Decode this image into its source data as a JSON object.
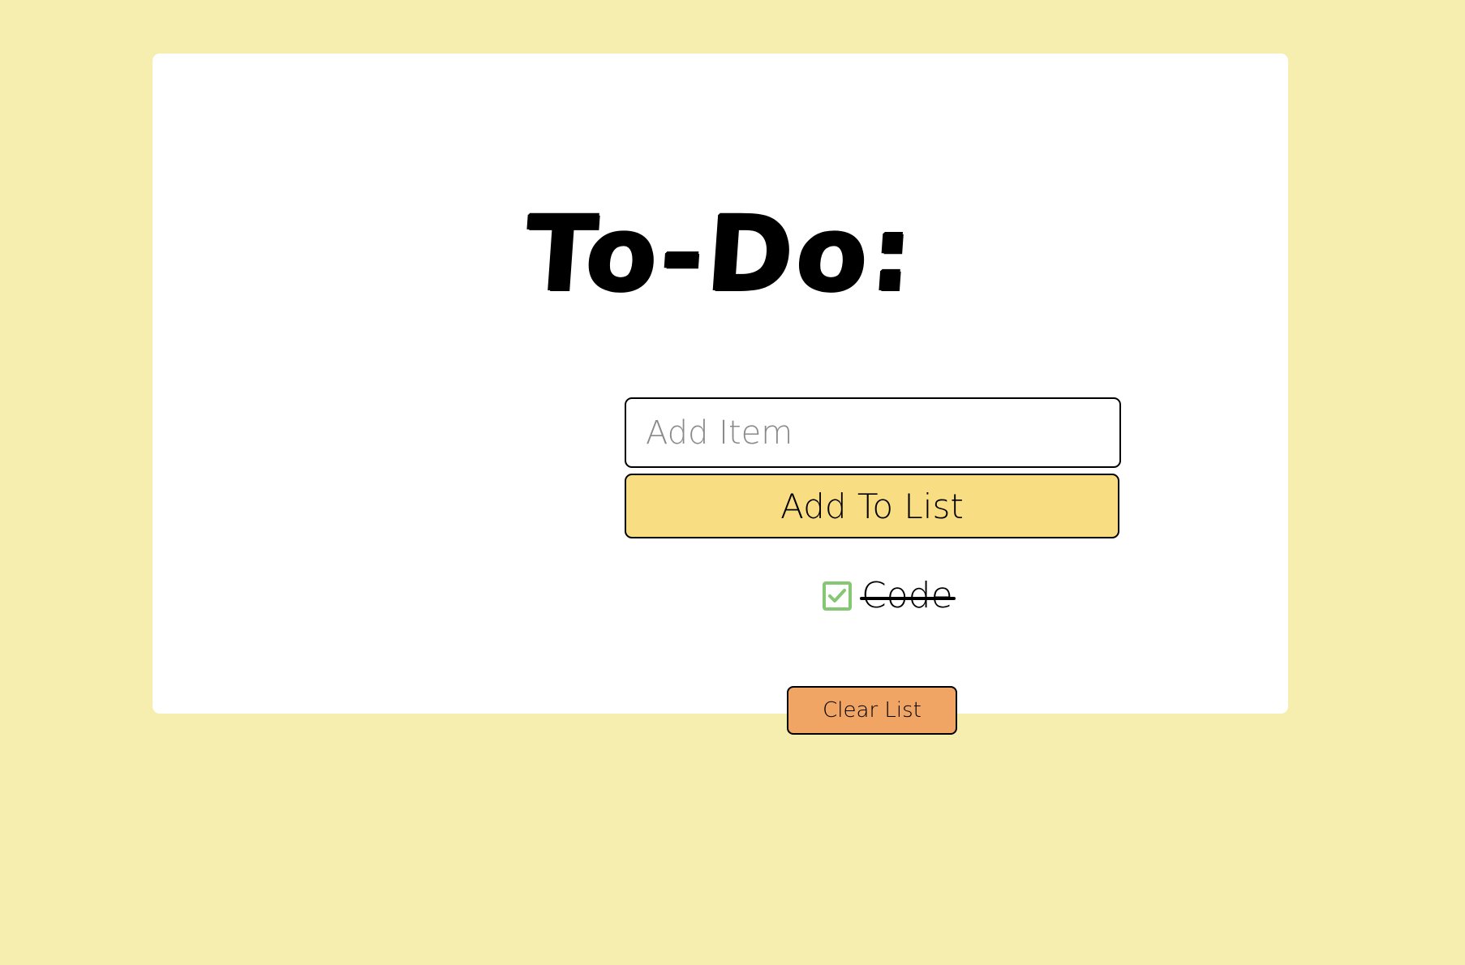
{
  "page": {
    "background_color": "#F5EEAF",
    "card_color": "#FFFFFF"
  },
  "header": {
    "title": "To-Do:"
  },
  "add_item": {
    "placeholder": "Add Item",
    "value": "",
    "button_label": "Add To List",
    "button_color": "#F9DD83"
  },
  "todo_list": {
    "items": [
      {
        "label": "Code",
        "checked": true,
        "checkbox_color": "#86C774",
        "check_icon": "check-icon"
      }
    ]
  },
  "actions": {
    "clear_label": "Clear List",
    "clear_color": "#F0A564"
  }
}
